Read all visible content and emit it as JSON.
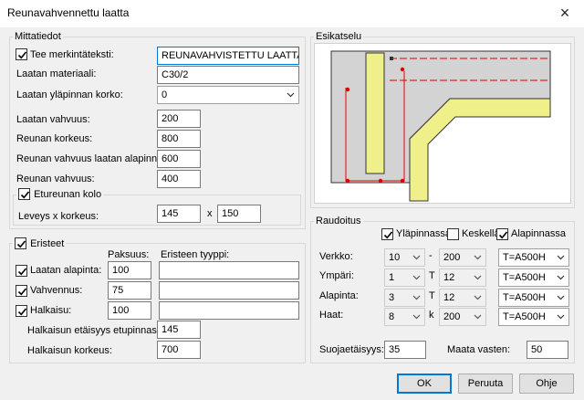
{
  "window": {
    "title": "Reunavahvennettu laatta",
    "close_icon": "×"
  },
  "mittatiedot": {
    "group_label": "Mittatiedot",
    "merkinta": {
      "label": "Tee merkintäteksti:",
      "value": "REUNAVAHVISTETTU LAATTA",
      "checked": true
    },
    "materiaali": {
      "label": "Laatan materiaali:",
      "value": "C30/2"
    },
    "korko": {
      "label": "Laatan yläpinnan korko:",
      "value": "0"
    },
    "vahvuus": {
      "label": "Laatan vahvuus:",
      "value": "200"
    },
    "reunan_korkeus": {
      "label": "Reunan korkeus:",
      "value": "800"
    },
    "reunan_vahvuus_alapinnassa": {
      "label": "Reunan vahvuus laatan alapinnassa:",
      "value": "600"
    },
    "reunan_vahvuus": {
      "label": "Reunan vahvuus:",
      "value": "400"
    },
    "etureunan_kolo": {
      "label": "Etureunan kolo",
      "checked": true,
      "dims_label": "Leveys x korkeus:",
      "width": "145",
      "times": "x",
      "height": "150"
    }
  },
  "eristeet": {
    "label": "Eristeet",
    "checked": true,
    "paksuus_header": "Paksuus:",
    "tyyppi_header": "Eristeen tyyppi:",
    "rows": [
      {
        "label": "Laatan alapinta:",
        "checked": true,
        "paksuus": "100",
        "tyyppi": ""
      },
      {
        "label": "Vahvennus:",
        "checked": true,
        "paksuus": "75",
        "tyyppi": ""
      },
      {
        "label": "Halkaisu:",
        "checked": true,
        "paksuus": "100",
        "tyyppi": ""
      }
    ],
    "halkaisu_etaisyys": {
      "label": "Halkaisun etäisyys etupinnasta:",
      "value": "145"
    },
    "halkaisu_korkeus": {
      "label": "Halkaisun korkeus:",
      "value": "700"
    }
  },
  "esikatselu": {
    "group_label": "Esikatselu"
  },
  "raudoitus": {
    "group_label": "Raudoitus",
    "checks": [
      {
        "label": "Yläpinnassa",
        "checked": true
      },
      {
        "label": "Keskellä",
        "checked": false
      },
      {
        "label": "Alapinnassa",
        "checked": true
      }
    ],
    "rows": [
      {
        "label": "Verkko:",
        "size": "10",
        "sep": "-",
        "spacing": "200",
        "grade": "T=A500H"
      },
      {
        "label": "Ympäri:",
        "size": "1",
        "sep": "T",
        "spacing": "12",
        "grade": "T=A500H"
      },
      {
        "label": "Alapinta:",
        "size": "3",
        "sep": "T",
        "spacing": "12",
        "grade": "T=A500H"
      },
      {
        "label": "Haat:",
        "size": "8",
        "sep": "k",
        "spacing": "200",
        "grade": "T=A500H"
      }
    ],
    "suojaetaisyys": {
      "label": "Suojaetäisyys:",
      "value": "35"
    },
    "maata_vasten": {
      "label": "Maata vasten:",
      "value": "50"
    }
  },
  "buttons": {
    "ok": "OK",
    "peruuta": "Peruuta",
    "ohje": "Ohje"
  },
  "colors": {
    "accent": "#0078d7",
    "insulation": "#f0f08a",
    "concrete": "#d3d3d3",
    "rebar": "#e00000"
  }
}
